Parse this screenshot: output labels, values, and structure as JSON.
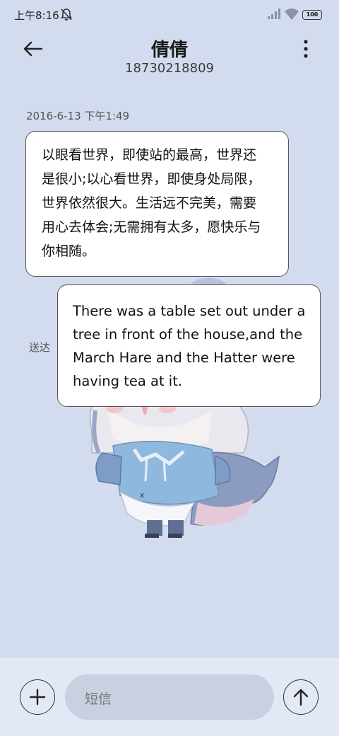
{
  "status_bar": {
    "time": "上午8:16",
    "battery": "100",
    "icons": [
      "mute-icon",
      "signal-icon",
      "wifi-icon",
      "battery-icon"
    ]
  },
  "header": {
    "contact_name": "倩倩",
    "phone_number": "18730218809",
    "icons": [
      "back-arrow-icon",
      "more-vertical-icon"
    ]
  },
  "conversation": {
    "timestamp": "2016-6-13 下午1:49",
    "status": "送达",
    "messages": [
      {
        "lines": [
          "以眼看世界，即使站的最高，世界还",
          "是很小;以心看世界，即使身处局限，",
          "世界依然很大。生活远不完美，需要",
          "用心去体会;无需拥有太多，愿快乐与",
          "你相随。"
        ]
      },
      {
        "lines": [
          "There was a table set out under a",
          "tree in front of the house,and the",
          "March Hare and the Hatter were",
          "having tea at it."
        ]
      }
    ]
  },
  "composer": {
    "placeholder": "短信",
    "icons": [
      "plus-icon",
      "send-arrow-icon"
    ]
  },
  "colors": {
    "background": "#d3dcef",
    "bubble": "#ffffff",
    "input_field": "#c9d0e1"
  }
}
